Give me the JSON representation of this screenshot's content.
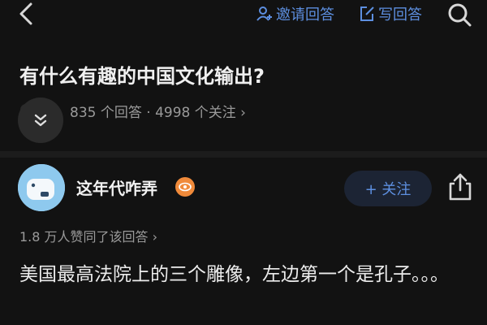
{
  "topbar": {
    "invite_label": "邀请回答",
    "write_label": "写回答"
  },
  "question": {
    "title": "有什么有趣的中国文化输出?",
    "stats": "835 个回答 · 4998 个关注 ›"
  },
  "answer": {
    "author": "这年代咋弄",
    "follow_label": "+ 关注",
    "agree_text": "1.8 万人赞同了该回答 ›",
    "content": "美国最高法院上的三个雕像，左边第一个是孔子。。。"
  },
  "colors": {
    "background": "#121212",
    "accent": "#5d8fe0",
    "follow_bg": "#1c2434",
    "badge": "#f08a3a"
  },
  "icons": [
    "back-icon",
    "add-person-icon",
    "edit-icon",
    "search-icon",
    "chevron-double-down-icon",
    "eye-badge-icon",
    "share-icon"
  ]
}
